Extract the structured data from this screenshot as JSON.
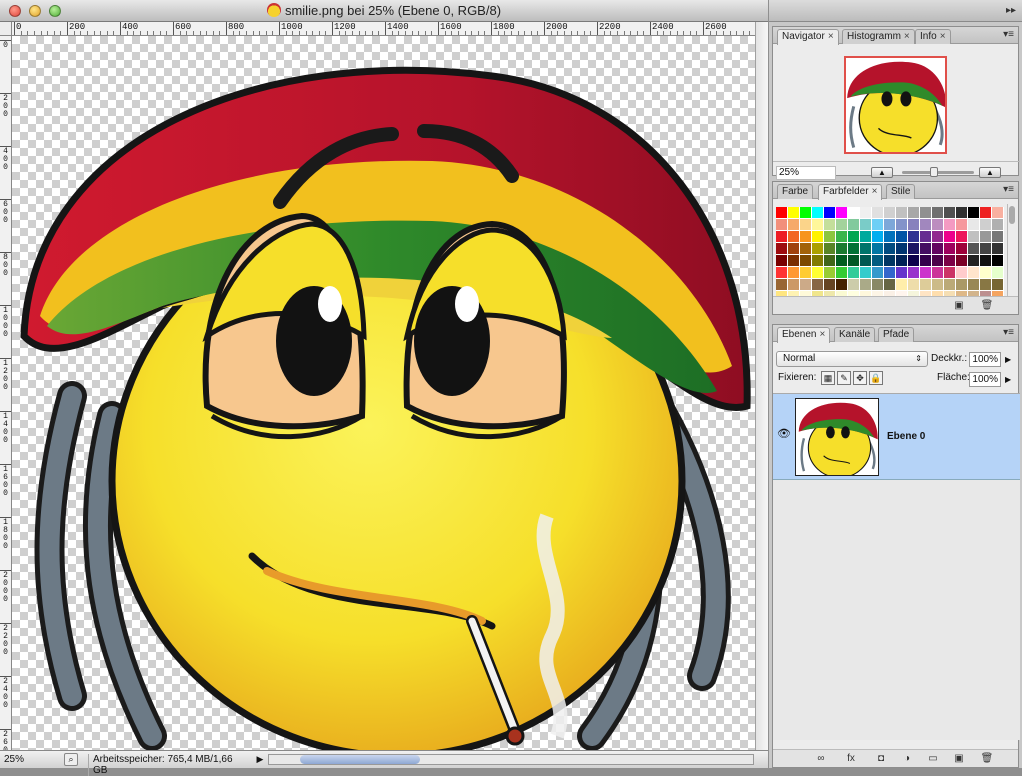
{
  "window": {
    "title": "smilie.png bei 25% (Ebene 0, RGB/8)"
  },
  "rulers": {
    "horizontal": [
      "0",
      "200",
      "400",
      "600",
      "800",
      "1000",
      "1200",
      "1400",
      "1600",
      "1800",
      "2000",
      "2200",
      "2400",
      "2600",
      "2800"
    ],
    "vertical": [
      "0",
      "200",
      "400",
      "600",
      "800",
      "1000",
      "1200",
      "1400",
      "1600",
      "1800",
      "2000",
      "2200",
      "2400",
      "2600"
    ]
  },
  "status": {
    "zoom": "25%",
    "memory": "Arbeitsspeicher: 765,4 MB/1,66 GB"
  },
  "navigator_panel": {
    "tabs": [
      "Navigator",
      "Histogramm",
      "Info"
    ],
    "zoom_value": "25%"
  },
  "color_panel": {
    "tabs": [
      "Farbe",
      "Farbfelder",
      "Stile"
    ],
    "swatch_colors": [
      "#ff0000",
      "#ffff00",
      "#00ff00",
      "#00ffff",
      "#0000ff",
      "#ff00ff",
      "#ffffff",
      "#f0f0f0",
      "#e0e0e0",
      "#d0d0d0",
      "#c0c0c0",
      "#a8a8a8",
      "#909090",
      "#707070",
      "#505050",
      "#303030",
      "#000000",
      "#ee2222",
      "#f9b0a0",
      "#f28f7b",
      "#f6a96a",
      "#fbd48a",
      "#fff79a",
      "#c4df9b",
      "#a3d39c",
      "#82ca9d",
      "#7accc8",
      "#6dcff6",
      "#7da7d9",
      "#8393ca",
      "#8781bd",
      "#a187be",
      "#bc8dbf",
      "#f49ac2",
      "#f6989d",
      "#e8e8e8",
      "#cfcfcf",
      "#b0b0b0",
      "#ed1c24",
      "#f26522",
      "#f7941d",
      "#fff200",
      "#8dc63f",
      "#39b54a",
      "#00a651",
      "#00a99d",
      "#00aeef",
      "#0072bc",
      "#0054a6",
      "#2e3192",
      "#662d91",
      "#92278f",
      "#ec008c",
      "#ed145b",
      "#c0c0c0",
      "#999999",
      "#777777",
      "#9e0b0f",
      "#a0410d",
      "#a36209",
      "#aba000",
      "#598527",
      "#1a7b30",
      "#007236",
      "#00746b",
      "#0076a3",
      "#004b80",
      "#003471",
      "#1b1464",
      "#440e62",
      "#630460",
      "#9e005d",
      "#9e0039",
      "#555555",
      "#444444",
      "#333333",
      "#790000",
      "#7b2e00",
      "#7d4900",
      "#827b00",
      "#406618",
      "#005e20",
      "#005826",
      "#005952",
      "#005b7f",
      "#003663",
      "#002157",
      "#0d004c",
      "#32004b",
      "#4b0049",
      "#7b0046",
      "#7a0026",
      "#222222",
      "#111111",
      "#000000",
      "#ff3333",
      "#ff9933",
      "#ffcc33",
      "#ffff33",
      "#99cc33",
      "#33cc33",
      "#33cc99",
      "#33cccc",
      "#3399cc",
      "#3366cc",
      "#6633cc",
      "#9933cc",
      "#cc33cc",
      "#cc3399",
      "#cc3366",
      "#ffcccc",
      "#ffe5cc",
      "#ffffcc",
      "#e5ffcc",
      "#996633",
      "#cc9966",
      "#ccaa88",
      "#886644",
      "#664422",
      "#442200",
      "#ccccaa",
      "#aaaa88",
      "#888866",
      "#666644",
      "#ffeeaa",
      "#eeddaa",
      "#ddcc99",
      "#ccbb88",
      "#bbaa77",
      "#aa9966",
      "#998855",
      "#887744",
      "#776633",
      "#ffe680",
      "#fff3b3",
      "#fffad9",
      "#f0e68c",
      "#eee8aa",
      "#fafad2",
      "#ffffe0",
      "#fff8dc",
      "#fdf5e6",
      "#faf0e6",
      "#fff5ee",
      "#f5f5dc",
      "#ffe4c4",
      "#ffdead",
      "#f5deb3",
      "#deb887",
      "#d2b48c",
      "#bc8f8f",
      "#f4a460"
    ]
  },
  "layers_panel": {
    "tabs": [
      "Ebenen",
      "Kanäle",
      "Pfade"
    ],
    "blend_mode": "Normal",
    "opacity_label": "Deckkr.:",
    "opacity_value": "100%",
    "lock_label": "Fixieren:",
    "fill_label": "Fläche:",
    "fill_value": "100%",
    "layers": [
      {
        "name": "Ebene 0",
        "visible": true,
        "selected": true
      }
    ]
  },
  "icons": {
    "eye": "eye-icon",
    "link": "link-icon",
    "fx": "fx-icon",
    "mask": "mask-icon",
    "adjust": "adjustment-icon",
    "folder": "folder-icon",
    "new_layer": "new-layer-icon",
    "trash": "trash-icon"
  },
  "colors": {
    "selection_blue": "#b5d3f7",
    "nav_box": "#e0504a",
    "hat_red": "#b5132b",
    "hat_yellow": "#f2c01e",
    "hat_green": "#2f8a2a",
    "face_yellow": "#f6df2a"
  }
}
